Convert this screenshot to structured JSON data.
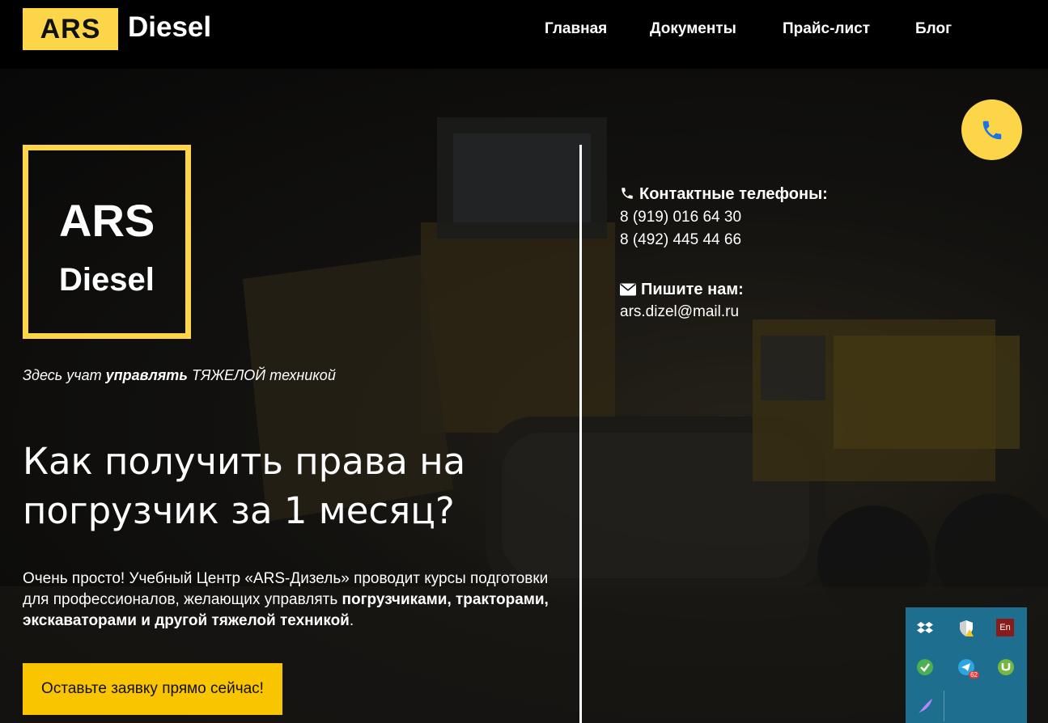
{
  "header": {
    "brand_badge": "ARS",
    "brand_text": "Diesel",
    "nav": [
      {
        "label": "Главная"
      },
      {
        "label": "Документы"
      },
      {
        "label": "Прайс-лист"
      },
      {
        "label": "Блог"
      }
    ]
  },
  "hero": {
    "logo": {
      "line1": "ARS",
      "line2": "Diesel"
    },
    "tagline": {
      "pre": "Здесь учат ",
      "bold": "управлять",
      "post": " ТЯЖЕЛОЙ техникой"
    },
    "headline": "Как получить права на погрузчик за 1 месяц?",
    "intro": {
      "text": "Очень просто! Учебный Центр «ARS-Дизель» проводит курсы подготовки для профессионалов, желающих управлять ",
      "bold": "погрузчиками, тракторами, экскаваторами и другой тяжелой техникой",
      "end": "."
    },
    "cta_label": "Оставьте заявку прямо сейчас!"
  },
  "contacts": {
    "phones_heading": "Контактные телефоны:",
    "phones": [
      "8 (919) 016 64 30",
      "8 (492) 445 44 66"
    ],
    "email_heading": "Пишите нам:",
    "email": "ars.dizel@mail.ru"
  },
  "tray": {
    "icons": [
      "dropbox-icon",
      "security-shield-icon",
      "language-en-icon",
      "check-app-icon",
      "telegram-icon",
      "utorrent-icon",
      "feather-icon"
    ],
    "language_label": "En",
    "telegram_badge": "62"
  },
  "colors": {
    "accent": "#fdd549",
    "cta": "#f9c500",
    "header_bg": "#000000",
    "phone_icon": "#1a73e8",
    "tray_bg": "#1e6e90"
  }
}
